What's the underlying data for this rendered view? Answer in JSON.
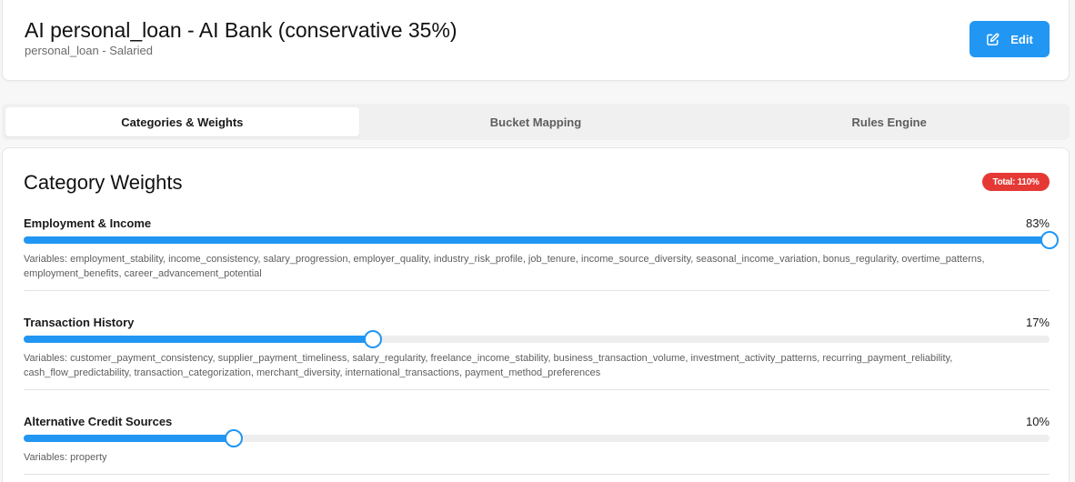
{
  "header": {
    "title": "AI personal_loan - AI Bank (conservative 35%)",
    "subtitle": "personal_loan - Salaried",
    "edit_label": "Edit"
  },
  "tabs": [
    {
      "label": "Categories & Weights",
      "active": true
    },
    {
      "label": "Bucket Mapping",
      "active": false
    },
    {
      "label": "Rules Engine",
      "active": false
    }
  ],
  "weights": {
    "title": "Category Weights",
    "total_label": "Total: 110%",
    "categories": [
      {
        "name": "Employment & Income",
        "percent_label": "83%",
        "slider_fraction": 1.0,
        "variables": "Variables: employment_stability, income_consistency, salary_progression, employer_quality, industry_risk_profile, job_tenure, income_source_diversity, seasonal_income_variation, bonus_regularity, overtime_patterns, employment_benefits, career_advancement_potential"
      },
      {
        "name": "Transaction History",
        "percent_label": "17%",
        "slider_fraction": 0.34,
        "variables": "Variables: customer_payment_consistency, supplier_payment_timeliness, salary_regularity, freelance_income_stability, business_transaction_volume, investment_activity_patterns, recurring_payment_reliability, cash_flow_predictability, transaction_categorization, merchant_diversity, international_transactions, payment_method_preferences"
      },
      {
        "name": "Alternative Credit Sources",
        "percent_label": "10%",
        "slider_fraction": 0.205,
        "variables": "Variables: property"
      }
    ]
  },
  "colors": {
    "accent": "#2196f3",
    "badge": "#e53935"
  }
}
